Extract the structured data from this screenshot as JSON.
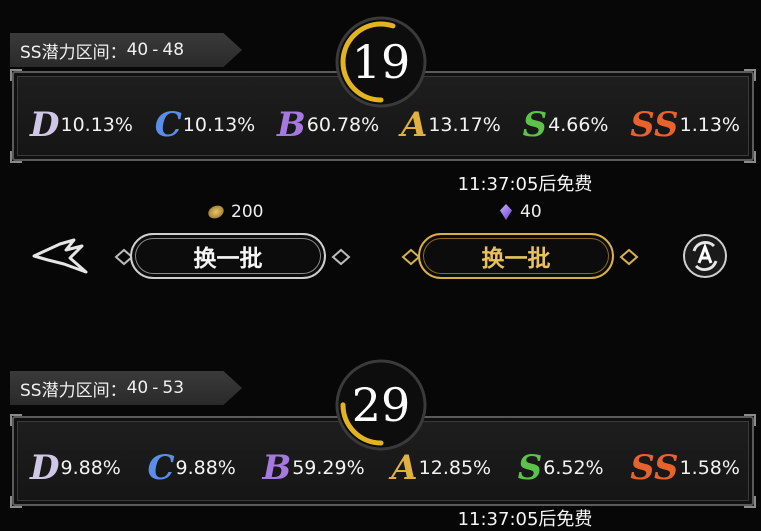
{
  "colors": {
    "D": "#cfc7e6",
    "C": "#5a8ee8",
    "B": "#a57ae0",
    "A": "#e0b040",
    "S": "#5cc24a",
    "SS": "#e8622e",
    "gold": "#e8c15a",
    "level_arc": "#e3b41e"
  },
  "panels": [
    {
      "range_label": "SS潜力区间：",
      "range_low": "40",
      "range_sep": "-",
      "range_high": "48",
      "level": "19",
      "level_progress": 0.55,
      "rates": [
        {
          "grade": "D",
          "pct": "10.13%"
        },
        {
          "grade": "C",
          "pct": "10.13%"
        },
        {
          "grade": "B",
          "pct": "60.78%"
        },
        {
          "grade": "A",
          "pct": "13.17%"
        },
        {
          "grade": "S",
          "pct": "4.66%"
        },
        {
          "grade": "SS",
          "pct": "1.13%"
        }
      ],
      "free_timer": "11:37:05后免费",
      "gold_cost": "200",
      "gem_cost": "40",
      "refresh_label": "换一批",
      "refresh_premium_label": "换一批"
    },
    {
      "range_label": "SS潜力区间：",
      "range_low": "40",
      "range_sep": "-",
      "range_high": "53",
      "level": "29",
      "level_progress": 0.25,
      "rates": [
        {
          "grade": "D",
          "pct": "9.88%"
        },
        {
          "grade": "C",
          "pct": "9.88%"
        },
        {
          "grade": "B",
          "pct": "59.29%"
        },
        {
          "grade": "A",
          "pct": "12.85%"
        },
        {
          "grade": "S",
          "pct": "6.52%"
        },
        {
          "grade": "SS",
          "pct": "1.58%"
        }
      ],
      "free_timer": "11:37:05后免费"
    }
  ],
  "icons": {
    "back": "back-arrow-icon",
    "auto": "auto-refresh-icon",
    "coin": "gold-coin-icon",
    "gem": "purple-gem-icon"
  }
}
